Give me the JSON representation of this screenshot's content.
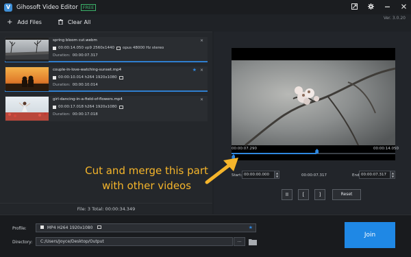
{
  "app": {
    "title": "Gihosoft Video Editor",
    "badge": "FREE",
    "version": "Ver. 3.0.20",
    "logo_letter": "V"
  },
  "titlebar_icons": [
    "share-icon",
    "settings-icon",
    "minimize-icon",
    "close-icon"
  ],
  "toolbar": {
    "add_files": "Add Files",
    "clear_all": "Clear All"
  },
  "files": [
    {
      "name": "spring bloom cut.webm",
      "info": "00:00:14.050 vp9 2560x1440",
      "audio": "opus 48000 Hz stereo",
      "duration_label": "Duration:",
      "duration": "00:00:07.317",
      "starred": false
    },
    {
      "name": "couple-in-love-watching-sunset.mp4",
      "info": "00:00:10.014 h264 1920x1080",
      "audio": "",
      "duration_label": "Duration:",
      "duration": "00:00:10.014",
      "starred": true
    },
    {
      "name": "girl-dancing-in-a-field-of-flowers.mp4",
      "info": "00:00:17.018 h264 1920x1080",
      "audio": "",
      "duration_label": "Duration:",
      "duration": "00:00:17.018",
      "starred": false
    }
  ],
  "summary": "File: 3   Total: 00:00:34.349",
  "player": {
    "time_current": "00:00:07.290",
    "time_total": "00:00:14.050",
    "progress": 0.52,
    "start_marker": 0.01,
    "end_marker": 0.52,
    "start_label": "Start:",
    "start_value": "00:00:00.000",
    "duration_mid": "00:00:07.317",
    "end_label": "End:",
    "end_value": "00:00:07.317",
    "pause": "II",
    "mark_in": "[",
    "mark_out": "]",
    "reset": "Reset"
  },
  "annotation": {
    "line1": "Cut  and merge this part",
    "line2": "with other videos",
    "color": "#f5b52b"
  },
  "bottom": {
    "profile_label": "Profile:",
    "profile_value": "MP4 H264 1920x1080",
    "directory_label": "Directory:",
    "directory_value": "C:/Users/Joyce/Desktop/Output",
    "browse": "...",
    "join": "Join"
  },
  "colors": {
    "accent": "#1f88e5",
    "badge": "#3bb36a"
  }
}
